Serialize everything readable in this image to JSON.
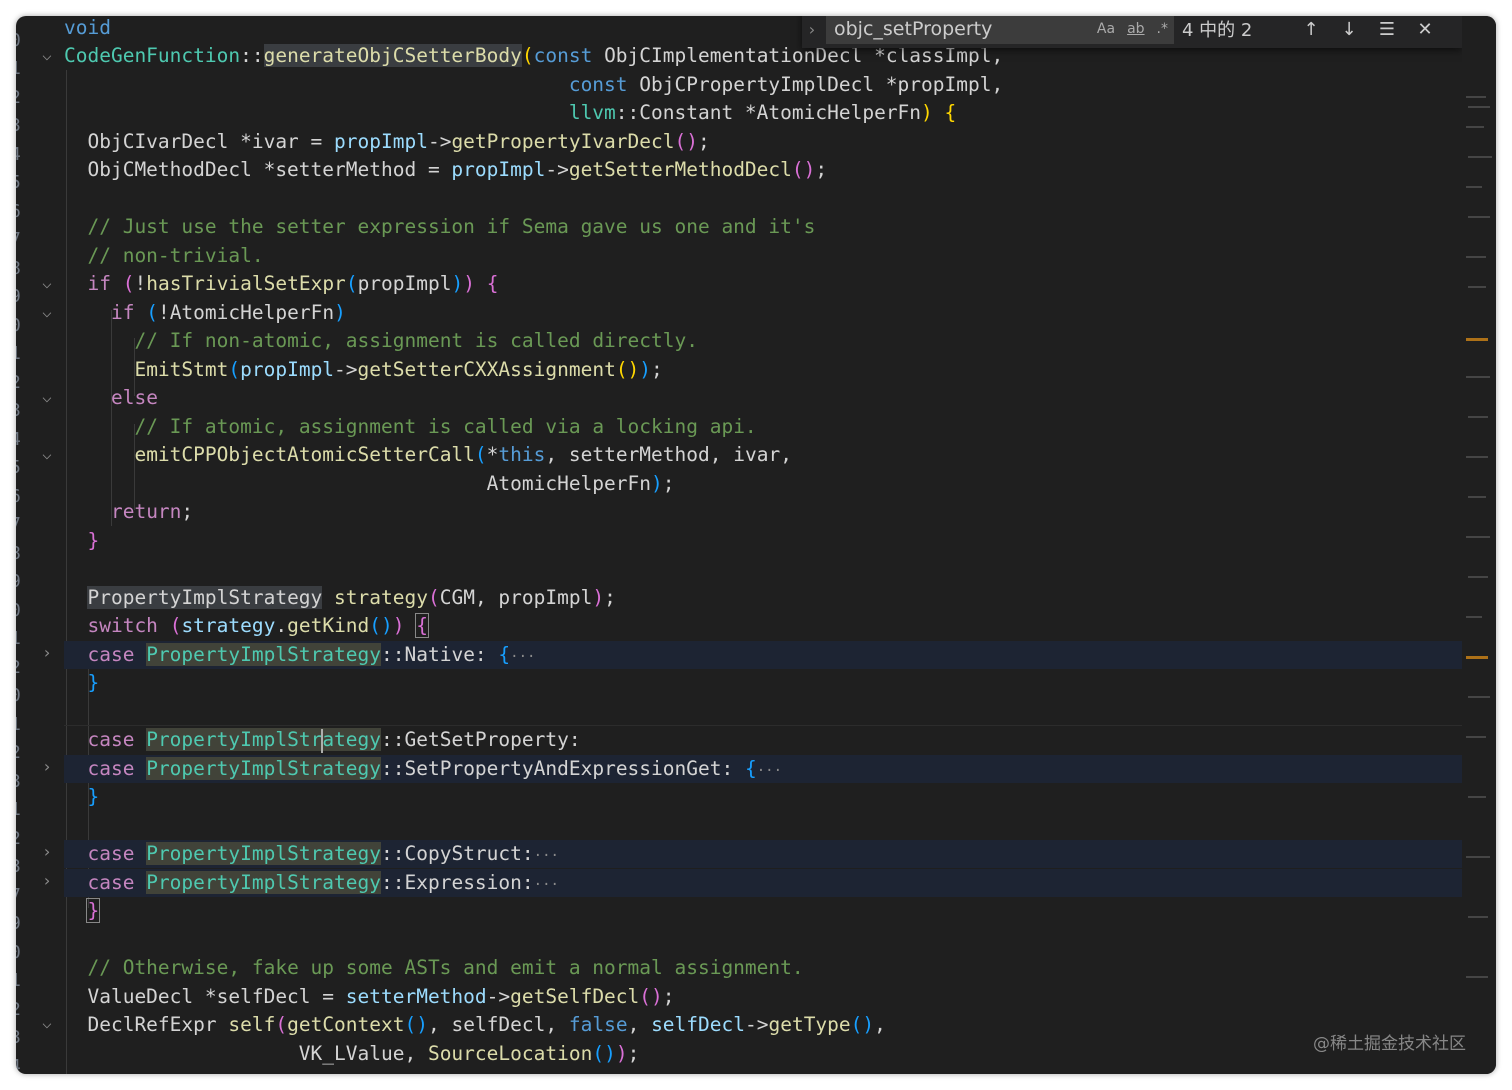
{
  "find": {
    "query": "objc_setProperty",
    "match_case": "Aa",
    "whole_word": "ab",
    "regex": ".*",
    "result_count": "4 中的 2"
  },
  "gutter": {
    "line_numbers": [
      "0",
      "1",
      "2",
      "3",
      "4",
      "5",
      "6",
      "7",
      "8",
      "9",
      "0",
      "1",
      "2",
      "3",
      "4",
      "5",
      "6",
      "7",
      "8",
      "9",
      "0",
      "1",
      "2",
      "0",
      "1",
      "2",
      "3",
      "1",
      "2",
      "3",
      "7",
      "9",
      "0",
      "1",
      "2",
      "3",
      "4"
    ]
  },
  "watermark": "@稀土掘金技术社区",
  "colors": {
    "background": "#1f1f1f",
    "keyword": "#c586c0",
    "type": "#4ec9b0",
    "function": "#dcdcaa",
    "comment": "#6a9955"
  }
}
